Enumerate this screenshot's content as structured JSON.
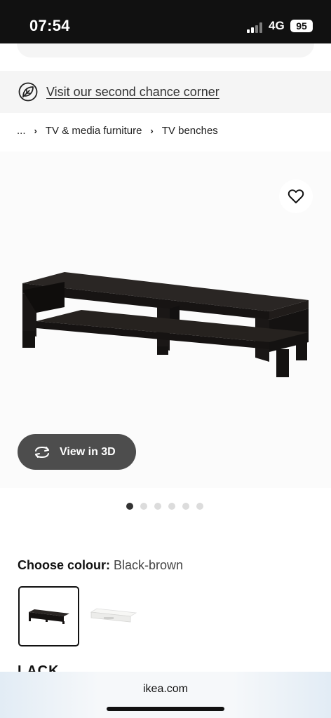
{
  "status_bar": {
    "time": "07:54",
    "network": "4G",
    "battery": "95"
  },
  "banner": {
    "icon": "leaf-icon",
    "link_text": "Visit our second chance corner"
  },
  "breadcrumb": {
    "items": [
      "...",
      "TV & media furniture",
      "TV benches"
    ]
  },
  "gallery": {
    "wishlist_icon": "heart-icon",
    "view_3d_label": "View in 3D",
    "view_3d_icon": "rotate-arrows-icon",
    "dot_count": 6,
    "active_dot_index": 0
  },
  "colour": {
    "label": "Choose colour:",
    "value": "Black-brown",
    "swatch_colors": [
      "#1e1a18",
      "#f4f4f2"
    ]
  },
  "product": {
    "name": "LACK"
  },
  "browser": {
    "address": "ikea.com"
  }
}
